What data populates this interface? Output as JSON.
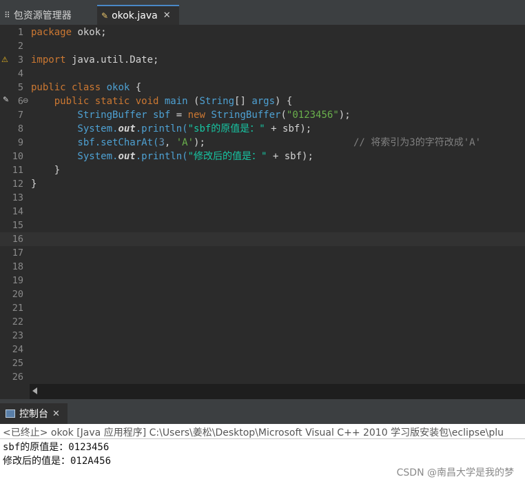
{
  "tabs": {
    "package_explorer": "包资源管理器",
    "editor_tab": "okok.java",
    "close_glyph": "✕"
  },
  "editor": {
    "lines": [
      {
        "n": "1"
      },
      {
        "n": "2"
      },
      {
        "n": "3"
      },
      {
        "n": "4"
      },
      {
        "n": "5"
      },
      {
        "n": "6"
      },
      {
        "n": "7"
      },
      {
        "n": "8"
      },
      {
        "n": "9"
      },
      {
        "n": "10"
      },
      {
        "n": "11"
      },
      {
        "n": "12"
      },
      {
        "n": "13"
      },
      {
        "n": "14"
      },
      {
        "n": "15"
      },
      {
        "n": "16"
      },
      {
        "n": "17"
      },
      {
        "n": "18"
      },
      {
        "n": "19"
      },
      {
        "n": "20"
      },
      {
        "n": "21"
      },
      {
        "n": "22"
      },
      {
        "n": "23"
      },
      {
        "n": "24"
      },
      {
        "n": "25"
      },
      {
        "n": "26"
      }
    ],
    "code": {
      "l1_kw": "package",
      "l1_rest": " okok;",
      "l3_kw": "import",
      "l3_rest": " java.util.Date;",
      "l5_kw": "public class",
      "l5_name": " okok",
      "l5_rest": " {",
      "l6_kw": "    public static void",
      "l6_name": " main",
      "l6_p1": " (",
      "l6_type": "String",
      "l6_p2": "[] ",
      "l6_args": "args",
      "l6_p3": ") {",
      "l7_type": "        StringBuffer",
      "l7_var": " sbf",
      "l7_eq": " = ",
      "l7_new": "new",
      "l7_type2": " StringBuffer",
      "l7_p": "(",
      "l7_str": "\"0123456\"",
      "l7_end": ");",
      "l8_sys": "        System.",
      "l8_out": "out",
      "l8_mid": ".println(",
      "l8_str": "\"sbf的原值是：\"",
      "l8_end": " + sbf);",
      "l9_a": "        sbf.setCharAt(",
      "l9_num": "3",
      "l9_b": ", ",
      "l9_chr": "'A'",
      "l9_c": ");",
      "l9_cm": "// 将索引为3的字符改成'A'",
      "l10_sys": "        System.",
      "l10_out": "out",
      "l10_mid": ".println(",
      "l10_str": "\"修改后的值是：\"",
      "l10_end": " + sbf);",
      "l11": "    }",
      "l12": "}"
    }
  },
  "console": {
    "tab_label": "控制台",
    "status": "<已终止> okok [Java 应用程序] C:\\Users\\姜松\\Desktop\\Microsoft Visual C++ 2010 学习版安装包\\eclipse\\plu",
    "output": [
      "sbf的原值是：0123456",
      "修改后的值是：012A456"
    ]
  },
  "watermark": "CSDN @南昌大学是我的梦"
}
